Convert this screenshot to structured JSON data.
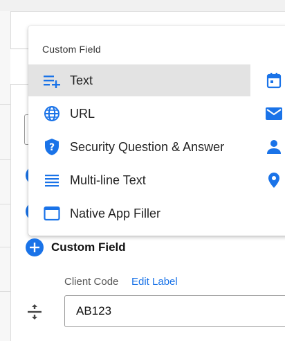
{
  "menu": {
    "heading": "Custom Field",
    "items": [
      {
        "label": "Text",
        "icon": "text-add-icon",
        "active": true
      },
      {
        "label": "URL",
        "icon": "globe-icon",
        "active": false
      },
      {
        "label": "Security Question & Answer",
        "icon": "shield-question-icon",
        "active": false
      },
      {
        "label": "Multi-line Text",
        "icon": "multiline-text-icon",
        "active": false
      },
      {
        "label": "Native App Filler",
        "icon": "app-window-icon",
        "active": false
      }
    ],
    "side_icons": [
      "calendar-icon",
      "email-icon",
      "person-icon",
      "location-pin-icon"
    ]
  },
  "add_custom_field": {
    "label": "Custom Field",
    "icon": "add-circle-icon"
  },
  "field": {
    "label": "Client Code",
    "edit_label": "Edit Label",
    "value": "AB123",
    "handle_icon": "drag-handle-icon"
  },
  "colors": {
    "accent": "#1a73e8",
    "active_row": "#e3e3e3"
  }
}
